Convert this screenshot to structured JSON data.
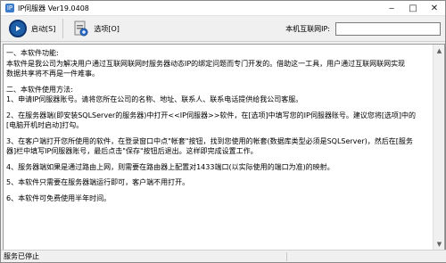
{
  "window": {
    "title": "IP伺服器 Ver19.0408",
    "app_icon": "app-icon"
  },
  "toolbar": {
    "start_label": "启动[S]",
    "options_label": "选项[O]",
    "ip_label": "本机互联网IP:",
    "ip_value": ""
  },
  "content": {
    "lines": [
      "一、本软件功能:",
      "    本软件是我公司为解决用户通过互联网联网时服务器动态IP的绑定问题而专门开发的。借助这一工具，用户通过互联网联网实现",
      "数据共享将不再是一件难事。",
      "",
      "二、本软件使用方法:",
      "    1、申请IP伺服器账号。请将您所在公司的名称、地址、联系人、联系电话提供给我公司客服。",
      "",
      "    2、在服务器端(即安装SQLServer的服务器)中打开<<IP伺服器>>软件，在[选项]中填写您的IP伺服器账号。建议您将[选项]中的",
      "[电脑开机时启动]打勾。",
      "",
      "    3、在客户端打开您所使用的软件，在登录窗口中点\"帐套\"按钮，找到您使用的帐套(数据库类型必须是SQLServer)，然后在[服务",
      "器]栏中填写IP伺服器账号，最后点击\"保存\"按钮后退出。这样即完成设置工作。",
      "",
      "    4、服务器端如果是通过路由上网，则需要在路由器上配置对1433端口(以实际使用的端口为准)的映射。",
      "",
      "    5、本软件只需要在服务器端运行即可，客户端不用打开。",
      "",
      "    6、本软件可免费使用半年时间。"
    ]
  },
  "status": {
    "text": "服务已停止"
  }
}
